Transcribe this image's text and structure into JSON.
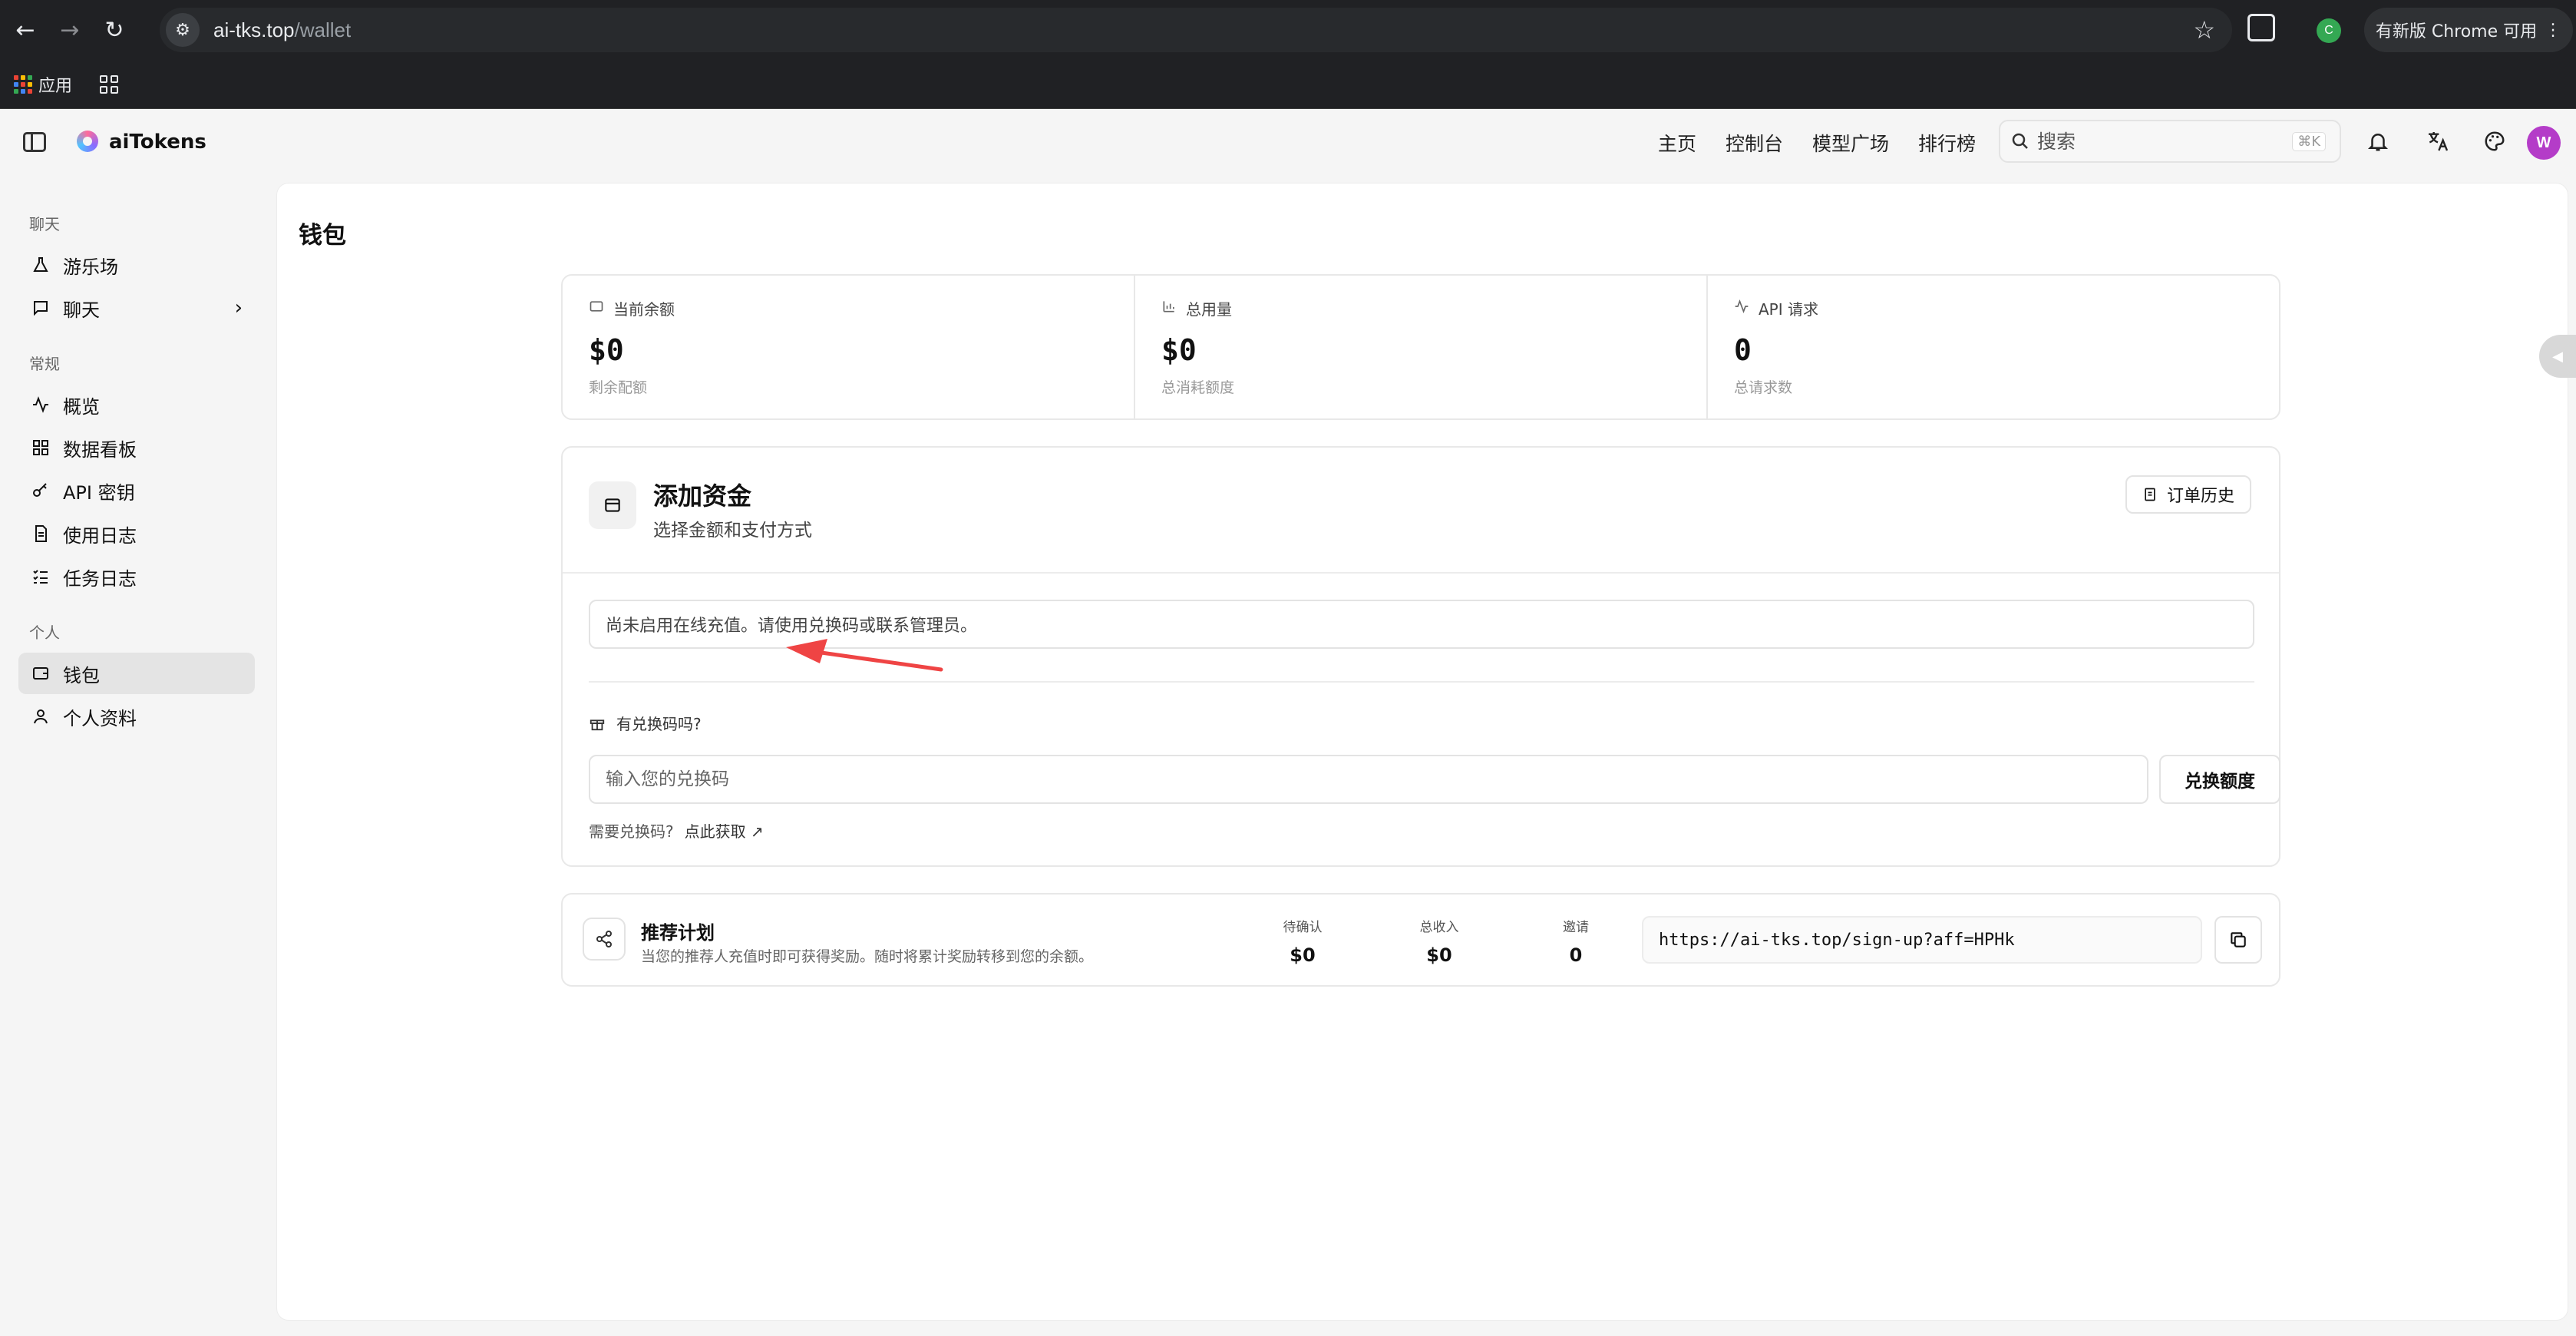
{
  "browser": {
    "url_host": "ai-tks.top",
    "url_path": "/wallet",
    "update_label": "有新版 Chrome 可用",
    "profile_letter": "C",
    "bookmarks": [
      {
        "label": "应用"
      }
    ]
  },
  "header": {
    "app_name": "aiTokens",
    "nav": [
      "主页",
      "控制台",
      "模型广场",
      "排行榜"
    ],
    "search_placeholder": "搜索",
    "search_shortcut": "⌘K",
    "avatar_letter": "W"
  },
  "sidebar": {
    "sections": [
      {
        "title": "聊天",
        "items": [
          {
            "label": "游乐场",
            "icon": "flask-icon"
          },
          {
            "label": "聊天",
            "icon": "chat-icon",
            "has_chevron": true
          }
        ]
      },
      {
        "title": "常规",
        "items": [
          {
            "label": "概览",
            "icon": "activity-icon"
          },
          {
            "label": "数据看板",
            "icon": "dashboard-icon"
          },
          {
            "label": "API 密钥",
            "icon": "key-icon"
          },
          {
            "label": "使用日志",
            "icon": "file-icon"
          },
          {
            "label": "任务日志",
            "icon": "list-icon"
          }
        ]
      },
      {
        "title": "个人",
        "items": [
          {
            "label": "钱包",
            "icon": "wallet-icon",
            "active": true
          },
          {
            "label": "个人资料",
            "icon": "user-icon"
          }
        ]
      }
    ]
  },
  "main": {
    "title": "钱包",
    "stats": [
      {
        "label": "当前余额",
        "value": "$0",
        "sub": "剩余配额",
        "icon": "wallet-icon"
      },
      {
        "label": "总用量",
        "value": "$0",
        "sub": "总消耗额度",
        "icon": "bar-chart-icon"
      },
      {
        "label": "API 请求",
        "value": "0",
        "sub": "总请求数",
        "icon": "activity-icon"
      }
    ],
    "funds": {
      "title": "添加资金",
      "subtitle": "选择金额和支付方式",
      "order_history_label": "订单历史",
      "notice": "尚未启用在线充值。请使用兑换码或联系管理员。",
      "redeem_label": "有兑换码吗?",
      "redeem_placeholder": "输入您的兑换码",
      "redeem_button": "兑换额度",
      "need_code": "需要兑换码?",
      "get_link": "点此获取"
    },
    "referral": {
      "title": "推荐计划",
      "subtitle": "当您的推荐人充值时即可获得奖励。随时将累计奖励转移到您的余额。",
      "stats": [
        {
          "label": "待确认",
          "value": "$0"
        },
        {
          "label": "总收入",
          "value": "$0"
        },
        {
          "label": "邀请",
          "value": "0"
        }
      ],
      "link": "https://ai-tks.top/sign-up?aff=HPHk"
    }
  },
  "colors": {
    "accent_avatar": "#b43cc8",
    "annotation_arrow": "#ef4444"
  }
}
